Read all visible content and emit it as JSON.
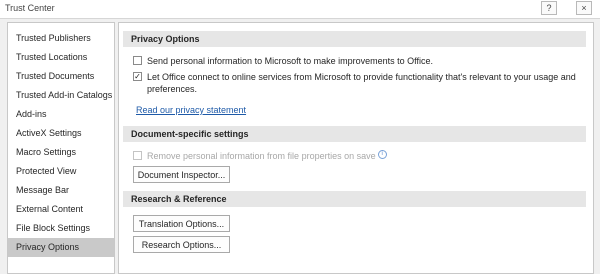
{
  "window": {
    "title": "Trust Center",
    "help_glyph": "?",
    "close_glyph": "×"
  },
  "sidebar": {
    "items": [
      {
        "label": "Trusted Publishers"
      },
      {
        "label": "Trusted Locations"
      },
      {
        "label": "Trusted Documents"
      },
      {
        "label": "Trusted Add-in Catalogs"
      },
      {
        "label": "Add-ins"
      },
      {
        "label": "ActiveX Settings"
      },
      {
        "label": "Macro Settings"
      },
      {
        "label": "Protected View"
      },
      {
        "label": "Message Bar"
      },
      {
        "label": "External Content"
      },
      {
        "label": "File Block Settings"
      },
      {
        "label": "Privacy Options",
        "selected": true
      }
    ]
  },
  "privacy": {
    "header": "Privacy Options",
    "send_info": {
      "label": "Send personal information to Microsoft to make improvements to Office.",
      "checked": false
    },
    "connect_online": {
      "label": "Let Office connect to online services from Microsoft to provide functionality that's relevant to your usage and preferences.",
      "checked": true
    },
    "statement_link": "Read our privacy statement"
  },
  "document_specific": {
    "header": "Document-specific settings",
    "remove_info": {
      "label": "Remove personal information from file properties on save",
      "checked": false,
      "enabled": false
    },
    "inspector_button": "Document Inspector..."
  },
  "research": {
    "header": "Research & Reference",
    "translation_button": "Translation Options...",
    "research_button": "Research Options..."
  },
  "icons": {
    "check": "✓",
    "info": "i"
  }
}
